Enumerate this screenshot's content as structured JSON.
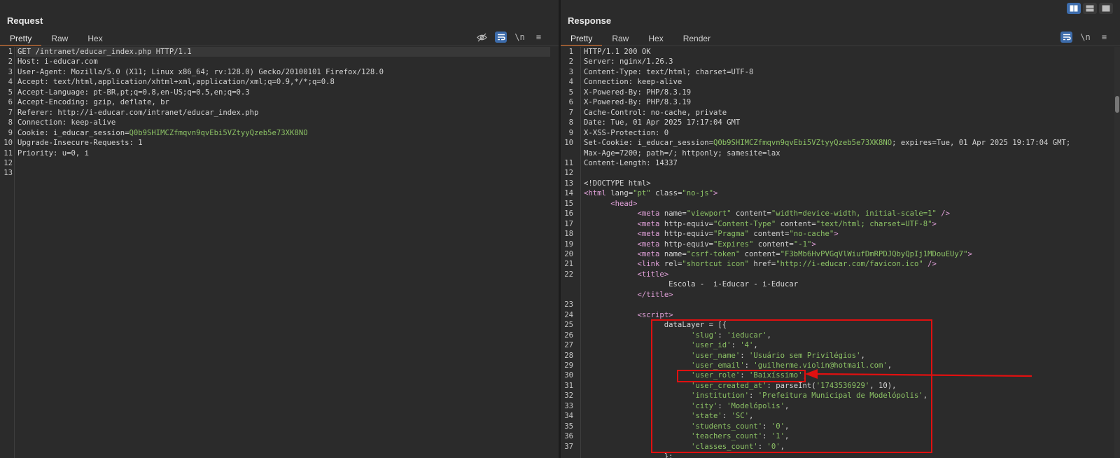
{
  "request": {
    "title": "Request",
    "tabs": [
      "Pretty",
      "Raw",
      "Hex"
    ],
    "lines": [
      [
        {
          "t": "GET /intranet/educar_index.php HTTP/1.1"
        }
      ],
      [
        {
          "t": "Host: i-educar.com"
        }
      ],
      [
        {
          "t": "User-Agent: Mozilla/5.0 (X11; Linux x86_64; rv:128.0) Gecko/20100101 Firefox/128.0"
        }
      ],
      [
        {
          "t": "Accept: text/html,application/xhtml+xml,application/xml;q=0.9,*/*;q=0.8"
        }
      ],
      [
        {
          "t": "Accept-Language: pt-BR,pt;q=0.8,en-US;q=0.5,en;q=0.3"
        }
      ],
      [
        {
          "t": "Accept-Encoding: gzip, deflate, br"
        }
      ],
      [
        {
          "t": "Referer: http://i-educar.com/intranet/educar_index.php"
        }
      ],
      [
        {
          "t": "Connection: keep-alive"
        }
      ],
      [
        {
          "t": "Cookie: i_educar_session="
        },
        {
          "t": "Q0b9SHIMCZfmqvn9qvEbi5VZtyyQzeb5e73XK8NO",
          "c": "g"
        }
      ],
      [
        {
          "t": "Upgrade-Insecure-Requests: 1"
        }
      ],
      [
        {
          "t": "Priority: u=0, i"
        }
      ],
      [
        {
          "t": ""
        }
      ],
      [
        {
          "t": ""
        }
      ]
    ]
  },
  "response": {
    "title": "Response",
    "tabs": [
      "Pretty",
      "Raw",
      "Hex",
      "Render"
    ],
    "lines": [
      {
        "n": "1",
        "s": [
          {
            "t": "HTTP/1.1 200 OK"
          }
        ]
      },
      {
        "n": "2",
        "s": [
          {
            "t": "Server: nginx/1.26.3"
          }
        ]
      },
      {
        "n": "3",
        "s": [
          {
            "t": "Content-Type: text/html; charset=UTF-8"
          }
        ]
      },
      {
        "n": "4",
        "s": [
          {
            "t": "Connection: keep-alive"
          }
        ]
      },
      {
        "n": "5",
        "s": [
          {
            "t": "X-Powered-By: PHP/8.3.19"
          }
        ]
      },
      {
        "n": "6",
        "s": [
          {
            "t": "X-Powered-By: PHP/8.3.19"
          }
        ]
      },
      {
        "n": "7",
        "s": [
          {
            "t": "Cache-Control: no-cache, private"
          }
        ]
      },
      {
        "n": "8",
        "s": [
          {
            "t": "Date: Tue, 01 Apr 2025 17:17:04 GMT"
          }
        ]
      },
      {
        "n": "9",
        "s": [
          {
            "t": "X-XSS-Protection: 0"
          }
        ]
      },
      {
        "n": "10",
        "s": [
          {
            "t": "Set-Cookie: i_educar_session="
          },
          {
            "t": "Q0b9SHIMCZfmqvn9qvEbi5VZtyyQzeb5e73XK8NO",
            "c": "g"
          },
          {
            "t": "; expires=Tue, 01 Apr 2025 19:17:04 GMT;"
          }
        ]
      },
      {
        "n": "",
        "s": [
          {
            "t": "Max-Age=7200; path=/; httponly; samesite=lax"
          }
        ]
      },
      {
        "n": "11",
        "s": [
          {
            "t": "Content-Length: 14337"
          }
        ]
      },
      {
        "n": "12",
        "s": [
          {
            "t": ""
          }
        ]
      },
      {
        "n": "13",
        "s": [
          {
            "t": "<!DOCTYPE html>"
          }
        ]
      },
      {
        "n": "14",
        "s": [
          {
            "t": "<html ",
            "c": "t"
          },
          {
            "t": "lang="
          },
          {
            "t": "\"pt\"",
            "c": "g"
          },
          {
            "t": " class="
          },
          {
            "t": "\"no-js\"",
            "c": "g"
          },
          {
            "t": ">",
            "c": "t"
          }
        ]
      },
      {
        "n": "15",
        "s": [
          {
            "t": "      "
          },
          {
            "t": "<head>",
            "c": "t"
          }
        ]
      },
      {
        "n": "16",
        "s": [
          {
            "t": "            "
          },
          {
            "t": "<meta ",
            "c": "t"
          },
          {
            "t": "name="
          },
          {
            "t": "\"viewport\"",
            "c": "g"
          },
          {
            "t": " content="
          },
          {
            "t": "\"width=device-width, initial-scale=1\"",
            "c": "g"
          },
          {
            "t": " />",
            "c": "t"
          }
        ]
      },
      {
        "n": "17",
        "s": [
          {
            "t": "            "
          },
          {
            "t": "<meta ",
            "c": "t"
          },
          {
            "t": "http-equiv="
          },
          {
            "t": "\"Content-Type\"",
            "c": "g"
          },
          {
            "t": " content="
          },
          {
            "t": "\"text/html; charset=UTF-8\"",
            "c": "g"
          },
          {
            "t": ">",
            "c": "t"
          }
        ]
      },
      {
        "n": "18",
        "s": [
          {
            "t": "            "
          },
          {
            "t": "<meta ",
            "c": "t"
          },
          {
            "t": "http-equiv="
          },
          {
            "t": "\"Pragma\"",
            "c": "g"
          },
          {
            "t": " content="
          },
          {
            "t": "\"no-cache\"",
            "c": "g"
          },
          {
            "t": ">",
            "c": "t"
          }
        ]
      },
      {
        "n": "19",
        "s": [
          {
            "t": "            "
          },
          {
            "t": "<meta ",
            "c": "t"
          },
          {
            "t": "http-equiv="
          },
          {
            "t": "\"Expires\"",
            "c": "g"
          },
          {
            "t": " content="
          },
          {
            "t": "\"-1\"",
            "c": "g"
          },
          {
            "t": ">",
            "c": "t"
          }
        ]
      },
      {
        "n": "20",
        "s": [
          {
            "t": "            "
          },
          {
            "t": "<meta ",
            "c": "t"
          },
          {
            "t": "name="
          },
          {
            "t": "\"csrf-token\"",
            "c": "g"
          },
          {
            "t": " content="
          },
          {
            "t": "\"F3bMb6HvPVGqVlWiufDmRPDJQbyQpIj1MDouEUy7\"",
            "c": "g"
          },
          {
            "t": ">",
            "c": "t"
          }
        ]
      },
      {
        "n": "21",
        "s": [
          {
            "t": "            "
          },
          {
            "t": "<link ",
            "c": "t"
          },
          {
            "t": "rel="
          },
          {
            "t": "\"shortcut icon\"",
            "c": "g"
          },
          {
            "t": " href="
          },
          {
            "t": "\"http://i-educar.com/favicon.ico\"",
            "c": "g"
          },
          {
            "t": " />",
            "c": "t"
          }
        ]
      },
      {
        "n": "22",
        "s": [
          {
            "t": "            "
          },
          {
            "t": "<title>",
            "c": "t"
          }
        ]
      },
      {
        "n": "",
        "s": [
          {
            "t": "                   Escola -  i-Educar - i-Educar"
          }
        ]
      },
      {
        "n": "",
        "s": [
          {
            "t": "            "
          },
          {
            "t": "</title>",
            "c": "t"
          }
        ]
      },
      {
        "n": "23",
        "s": [
          {
            "t": ""
          }
        ]
      },
      {
        "n": "24",
        "s": [
          {
            "t": "            "
          },
          {
            "t": "<script>",
            "c": "t"
          }
        ]
      },
      {
        "n": "25",
        "s": [
          {
            "t": "                  dataLayer = [{"
          }
        ]
      },
      {
        "n": "26",
        "s": [
          {
            "t": "                        "
          },
          {
            "t": "'slug'",
            "c": "g"
          },
          {
            "t": ": "
          },
          {
            "t": "'ieducar'",
            "c": "g"
          },
          {
            "t": ","
          }
        ]
      },
      {
        "n": "27",
        "s": [
          {
            "t": "                        "
          },
          {
            "t": "'user_id'",
            "c": "g"
          },
          {
            "t": ": "
          },
          {
            "t": "'4'",
            "c": "g"
          },
          {
            "t": ","
          }
        ]
      },
      {
        "n": "28",
        "s": [
          {
            "t": "                        "
          },
          {
            "t": "'user_name'",
            "c": "g"
          },
          {
            "t": ": "
          },
          {
            "t": "'Usuário sem Privilégios'",
            "c": "g"
          },
          {
            "t": ","
          }
        ]
      },
      {
        "n": "29",
        "s": [
          {
            "t": "                        "
          },
          {
            "t": "'user_email'",
            "c": "g"
          },
          {
            "t": ": "
          },
          {
            "t": "'guilherme.violin@hotmail.com'",
            "c": "g"
          },
          {
            "t": ","
          }
        ]
      },
      {
        "n": "30",
        "s": [
          {
            "t": "                        "
          },
          {
            "t": "'user_role'",
            "c": "g"
          },
          {
            "t": ": "
          },
          {
            "t": "'Baixíssimo'",
            "c": "g"
          },
          {
            "t": ","
          }
        ]
      },
      {
        "n": "31",
        "s": [
          {
            "t": "                        "
          },
          {
            "t": "'user_created_at'",
            "c": "g"
          },
          {
            "t": ": parseInt("
          },
          {
            "t": "'1743536929'",
            "c": "g"
          },
          {
            "t": ", 10),"
          }
        ]
      },
      {
        "n": "32",
        "s": [
          {
            "t": "                        "
          },
          {
            "t": "'institution'",
            "c": "g"
          },
          {
            "t": ": "
          },
          {
            "t": "'Prefeitura Municipal de Modelópolis'",
            "c": "g"
          },
          {
            "t": ","
          }
        ]
      },
      {
        "n": "33",
        "s": [
          {
            "t": "                        "
          },
          {
            "t": "'city'",
            "c": "g"
          },
          {
            "t": ": "
          },
          {
            "t": "'Modelópolis'",
            "c": "g"
          },
          {
            "t": ","
          }
        ]
      },
      {
        "n": "34",
        "s": [
          {
            "t": "                        "
          },
          {
            "t": "'state'",
            "c": "g"
          },
          {
            "t": ": "
          },
          {
            "t": "'SC'",
            "c": "g"
          },
          {
            "t": ","
          }
        ]
      },
      {
        "n": "35",
        "s": [
          {
            "t": "                        "
          },
          {
            "t": "'students_count'",
            "c": "g"
          },
          {
            "t": ": "
          },
          {
            "t": "'0'",
            "c": "g"
          },
          {
            "t": ","
          }
        ]
      },
      {
        "n": "36",
        "s": [
          {
            "t": "                        "
          },
          {
            "t": "'teachers_count'",
            "c": "g"
          },
          {
            "t": ": "
          },
          {
            "t": "'1'",
            "c": "g"
          },
          {
            "t": ","
          }
        ]
      },
      {
        "n": "37",
        "s": [
          {
            "t": "                        "
          },
          {
            "t": "'classes_count'",
            "c": "g"
          },
          {
            "t": ": "
          },
          {
            "t": "'0'",
            "c": "g"
          },
          {
            "t": ","
          }
        ]
      },
      {
        "n": "",
        "s": [
          {
            "t": "                  };"
          }
        ]
      }
    ]
  },
  "toolbar": {
    "newline_label": "\\n",
    "menu_label": "≡"
  },
  "colors": {
    "accent": "#e8762c",
    "highlight": "#e01010",
    "green": "#8cc265",
    "tag": "#e0a0d8",
    "toggle_on": "#3d6cab"
  },
  "icons": [
    "eye-off-icon",
    "wrap-icon",
    "newline-icon",
    "menu-icon",
    "layout-icon"
  ]
}
